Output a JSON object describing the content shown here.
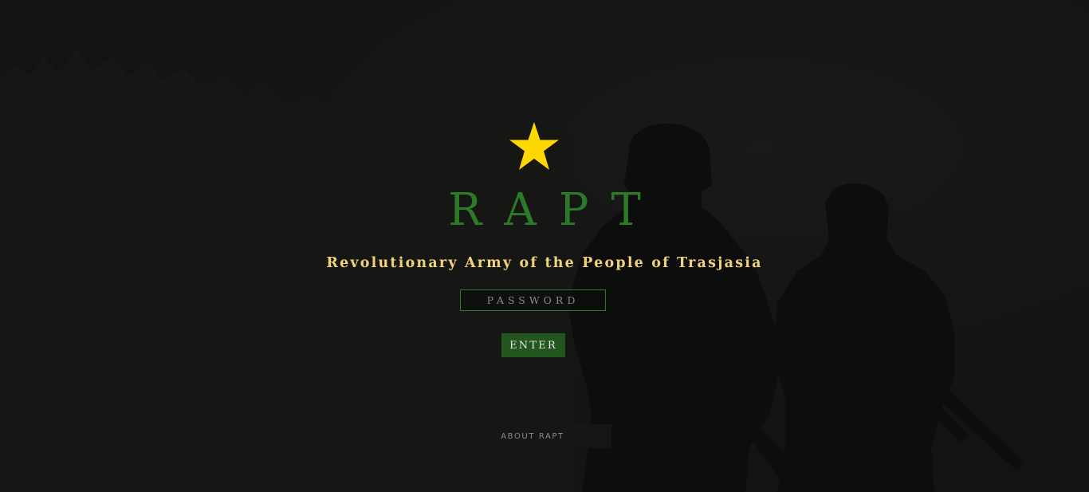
{
  "brand": {
    "title": "RAPT",
    "subtitle": "Revolutionary Army of the People of Trasjasia"
  },
  "login": {
    "password_placeholder": "PASSWORD",
    "enter_label": "ENTER"
  },
  "footer": {
    "about_label": "ABOUT RAPT"
  },
  "colors": {
    "background": "#141414",
    "star": "#ffd800",
    "title": "#2c7a28",
    "subtitle": "#efd27a",
    "button": "#23561f"
  },
  "icons": {
    "emblem": "star-icon"
  }
}
